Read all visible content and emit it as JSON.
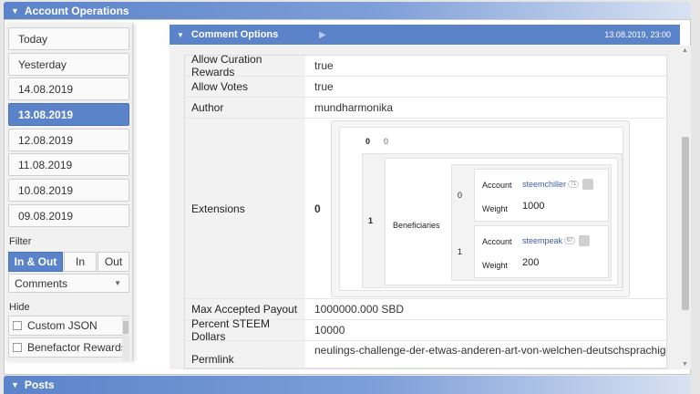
{
  "panels": {
    "ops_title": "Account Operations",
    "posts_title": "Posts"
  },
  "sidebar": {
    "dates": [
      "Today",
      "Yesterday",
      "14.08.2019",
      "13.08.2019",
      "12.08.2019",
      "11.08.2019",
      "10.08.2019",
      "09.08.2019"
    ],
    "active_date_index": 3,
    "filter_label": "Filter",
    "filter_options": [
      "In & Out",
      "In",
      "Out"
    ],
    "type_select": "Comments",
    "hide_label": "Hide",
    "hide_items": [
      "Custom JSON",
      "Benefactor Rewards"
    ]
  },
  "operation": {
    "title": "Comment Options",
    "timestamp": "13.08.2019, 23:00",
    "rows": [
      {
        "key": "Allow Curation Rewards",
        "value": "true"
      },
      {
        "key": "Allow Votes",
        "value": "true"
      },
      {
        "key": "Author",
        "value": "mundharmonika"
      },
      {
        "key": "Extensions",
        "value": "0"
      },
      {
        "key": "Max Accepted Payout",
        "value": "1000000.000 SBD"
      },
      {
        "key": "Percent STEEM Dollars",
        "value": "10000"
      },
      {
        "key": "Permlink",
        "value": "neulings-challenge-der-etwas-anderen-art-von-welchen-deutschsprachigen-"
      }
    ],
    "extensions": {
      "outer_index": "0",
      "top_key": "0",
      "top_value": "0",
      "inner_index": "1",
      "inner_label": "Beneficiaries",
      "beneficiaries": [
        {
          "index": "0",
          "account_label": "Account",
          "account": "steemchiller",
          "rep": "71",
          "weight_label": "Weight",
          "weight": "1000"
        },
        {
          "index": "1",
          "account_label": "Account",
          "account": "steempeak",
          "rep": "67",
          "weight_label": "Weight",
          "weight": "200"
        }
      ]
    }
  }
}
